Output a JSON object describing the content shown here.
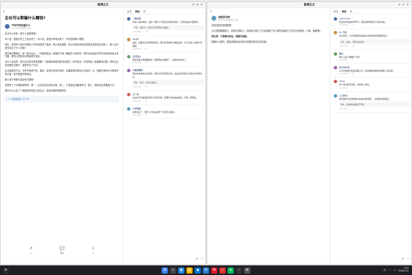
{
  "left_window": {
    "title": "微博正文",
    "article": {
      "title": "企业可以欺骗什么赚钱?",
      "author_name": "不码不吃的看什么",
      "author_sub": "1-11 06:23 发布于 北京",
      "paragraphs": [
        "企业可以叫你，是什么原因导致?",
        "有人说，是因为员工工资太低了；有人说，是因为市场太差了，环境没有那么理想。",
        "其实，是事有人强行将很多工作时间变成了投资，再以投资回报，而公司却没有将这份投资变成真正的收入。那么这中间究竟出了什么问题?",
        "首先我们要明白，有一部分企业，一开始就是由一批赚到了第一桶金的人投资的，他们对经营这件事情本身就没有太多兴趣，更关心的是资本的增值与退出。",
        "为什么会这样，因为企业的本质是需要一个能够持续盈利的商业模式，而不是靠一次性的投入就能解决问题。很多企业在发展的过程中，逐渐失去了方向。",
        "企业赚钱的方式，无外乎就是产品、服务、渠道与资本的运作。如果能够清楚地认识到这一点，就能在竞争中占据有利的位置，而不是被市场淘汰。",
        "那么接下来我们该如何去做呢?",
        "这里有三个方面值得思考：第一，企业的定位是否清晰；第二，产品是否具备竞争力；第三，团队是否具备执行力。",
        "我们可以从这三个维度来审视自己的企业，找到问题的根源所在。"
      ],
      "ai_box": "AI智能解读 • 问一问",
      "actions": [
        {
          "icon": "↗",
          "label": "1"
        },
        {
          "icon": "💬",
          "label": "评论"
        },
        {
          "icon": "☆",
          "label": "3"
        }
      ]
    },
    "comments": {
      "tabs": [
        "转发",
        "评论",
        "赞"
      ],
      "items": [
        {
          "user": "一路风景",
          "text": "有的人是这样的，说这个话的人不懂企业经营的本质，只知道站在外面批判。",
          "reply_user": "作者",
          "reply": "说得对，关键在于如何把企业做好。",
          "time": "1-11 08:23",
          "likes": "12"
        },
        {
          "user": "Rita菲",
          "text": "是的，如果企业不能持续盈利，那么所有的努力都会白费。员工的收入也得不到保障。",
          "reply_user": "",
          "reply": "",
          "time": "1-11 09:10",
          "likes": "5"
        },
        {
          "user": "古巴的古",
          "text": "很多老板只想着赚快钱，结果把企业做垮了，这种案例太多了。",
          "reply_user": "",
          "reply": "",
          "time": "1-11 10:02",
          "likes": "8"
        },
        {
          "user": "卡路里爆表",
          "text": "商业的本质是价值交换，没有价值就没有交换，企业必须为客户创造价值才能长久。",
          "reply_user": "网友",
          "reply": "同意，价值才是核心。",
          "time": "1-11 11:45",
          "likes": "21"
        },
        {
          "user": "王一波",
          "text": "企业在不同发展阶段有不同的问题，需要针对性地去解决，不能一概而论。",
          "reply_user": "",
          "reply": "",
          "time": "1-11 12:30",
          "likes": "3"
        },
        {
          "user": "大梦想家",
          "text": "说的太好了，我们公司就是这样一步步走过来的。",
          "reply_user": "",
          "reply": "",
          "time": "1-11 14:08",
          "likes": "6"
        }
      ]
    }
  },
  "right_window": {
    "title": "微博正文",
    "article": {
      "author_name": "智能的马斯",
      "author_sub": "1-11 06:40 发布于 上海",
      "paragraphs": [
        "目前还是在强调数据",
        "AI与逻辑推理能力，数量计算能力，应用各行能力上已经具备了可以替代初级的工作(无论是规划、行政、客服等)。",
        "首先是：不是替代岗位，是替代流程。",
        "数据可以替代，整套流程的自动化才是更值得关注的问题。"
      ],
      "red_line": "首先是：不是替代岗位，是替代流程。"
    },
    "comments": {
      "tabs": [
        "转发",
        "评论",
        "赞"
      ],
      "items": [
        {
          "user": "meiiinowen",
          "text": "真正替代的是中间环节，很多简单重复的工作会消失。",
          "reply_user": "",
          "reply": "",
          "time": "1-11 07:02",
          "likes": "4"
        },
        {
          "user": "Dr. 行研",
          "text": "完全同意，AI对流程的改造会比对岗位的改造更加深远。",
          "reply_user": "作者",
          "reply": "是的，流程才是关键。",
          "time": "1-11 07:40",
          "likes": "15"
        },
        {
          "user": "锦衣",
          "text": "那么以后人要做什么呢？",
          "reply_user": "",
          "reply": "",
          "time": "1-11 08:11",
          "likes": "2"
        },
        {
          "user": "老方的日常",
          "text": "认为AI能替代很多基础工作，但决策和判断依然需要人来完成。",
          "reply_user": "",
          "reply": "",
          "time": "1-11 08:55",
          "likes": "9"
        },
        {
          "user": "Alicia",
          "text": "这个观点很有意思，值得深入思考。",
          "reply_user": "",
          "reply": "",
          "time": "1-11 09:20",
          "likes": "1"
        },
        {
          "user": "三月的天",
          "text": "我们团队已经开始用AI优化内部流程了，效率提升很明显。",
          "reply_user": "网友",
          "reply": "具体用在哪些环节呢？",
          "time": "1-11 10:04",
          "likes": "7"
        }
      ]
    }
  },
  "taskbar": {
    "time": "9:03",
    "date": "2025/1/11",
    "lang": "中",
    "apps": [
      {
        "name": "start",
        "glyph": "⊞",
        "color": "#3b82f6"
      },
      {
        "name": "search",
        "glyph": "⌕",
        "color": "#444"
      },
      {
        "name": "browser",
        "glyph": "◉",
        "color": "#1e88e5"
      },
      {
        "name": "files",
        "glyph": "▤",
        "color": "#f5b400"
      },
      {
        "name": "store",
        "glyph": "◆",
        "color": "#0078d4"
      },
      {
        "name": "mail",
        "glyph": "✉",
        "color": "#2d7dd2"
      },
      {
        "name": "weibo",
        "glyph": "W",
        "color": "#e6162d"
      },
      {
        "name": "music",
        "glyph": "♪",
        "color": "#d33"
      },
      {
        "name": "chat",
        "glyph": "●",
        "color": "#07c160"
      },
      {
        "name": "terminal",
        "glyph": "›",
        "color": "#333"
      },
      {
        "name": "settings",
        "glyph": "⚙",
        "color": "#555"
      }
    ]
  }
}
